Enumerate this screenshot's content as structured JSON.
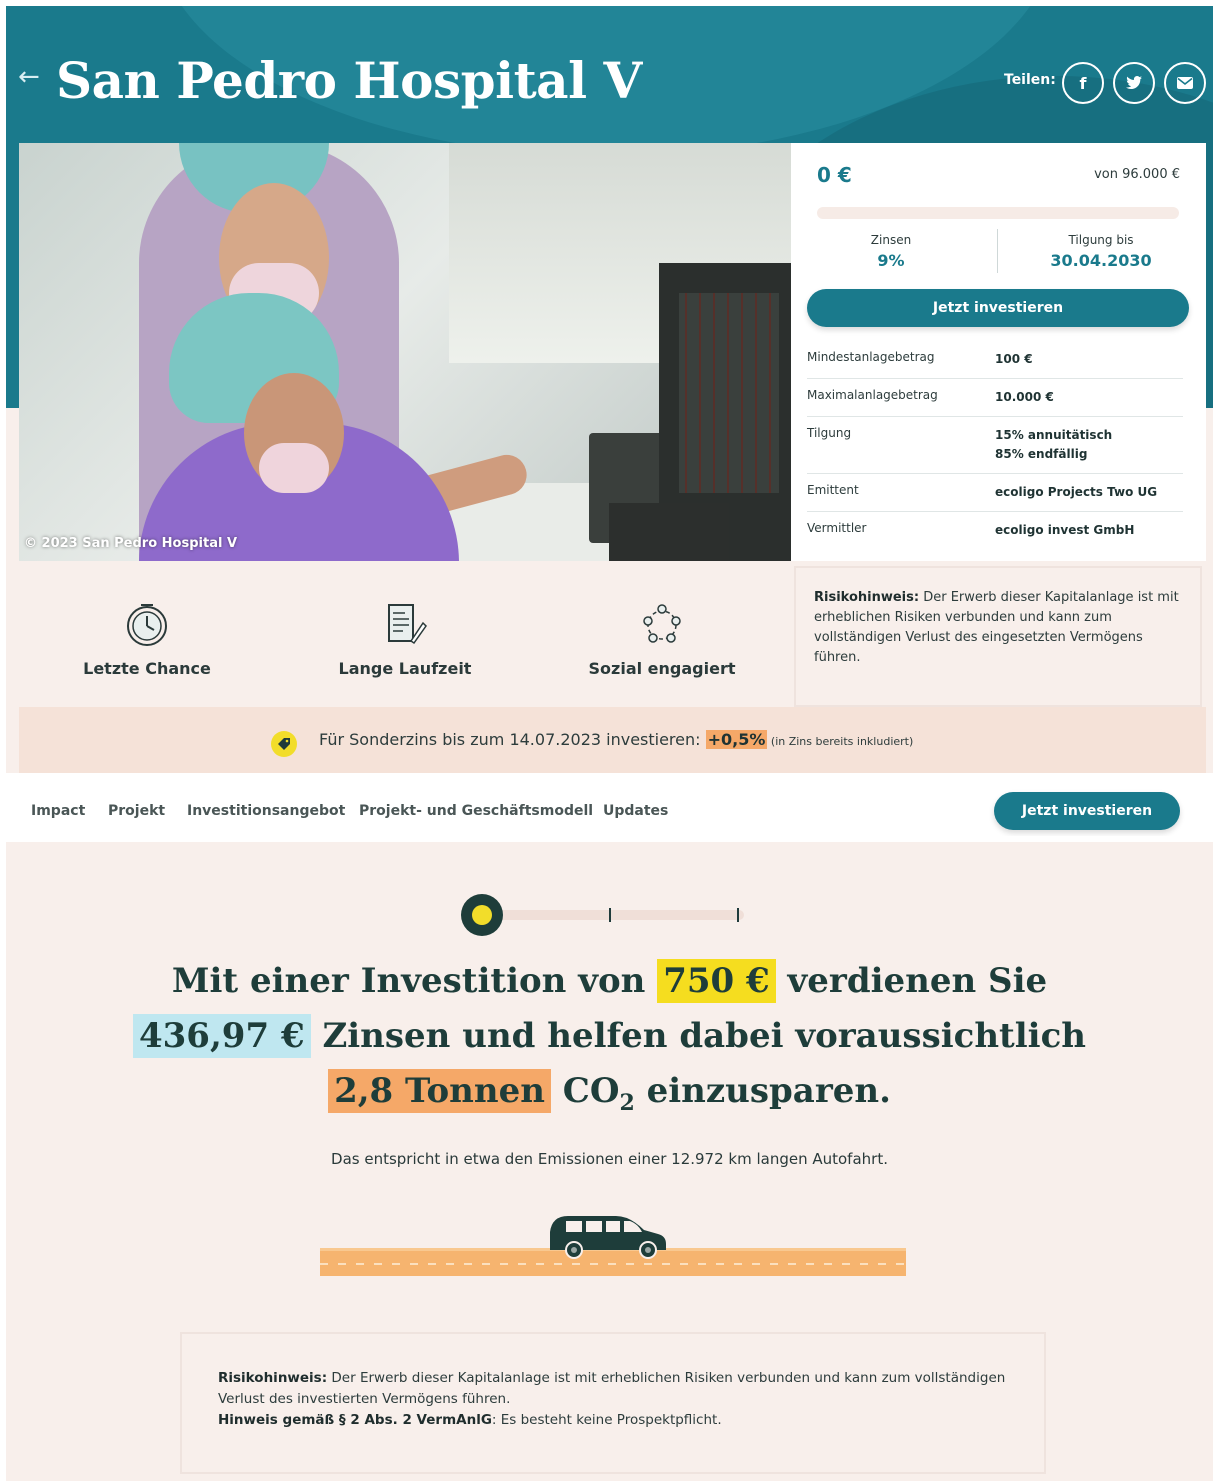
{
  "header": {
    "back_symbol": "←",
    "title": "San Pedro Hospital V",
    "share_label": "Teilen:",
    "share_buttons": [
      {
        "label": "f",
        "icon": "facebook-icon"
      },
      {
        "label": "t",
        "icon": "twitter-icon"
      },
      {
        "label": "✉",
        "icon": "mail-icon"
      }
    ]
  },
  "photo": {
    "caption": "© 2023 San Pedro Hospital V"
  },
  "invest_card": {
    "amount": "0 €",
    "of_total": "von 96.000 €",
    "progress": 0,
    "stats": [
      {
        "label": "Zinsen",
        "value": "9%"
      },
      {
        "label": "Tilgung bis",
        "value": "30.04.2030"
      }
    ],
    "cta_label": "Jetzt investieren",
    "details": [
      {
        "key": "Mindestanlagebetrag",
        "value": "100 €"
      },
      {
        "key": "Maximalanlagebetrag",
        "value": "10.000 €"
      },
      {
        "key": "Tilgung",
        "value": "15% annuitätisch\n85% endfällig"
      },
      {
        "key": "Emittent",
        "value": "ecoligo Projects Two UG"
      },
      {
        "key": "Vermittler",
        "value": "ecoligo invest GmbH"
      }
    ]
  },
  "features": [
    {
      "label": "Letzte Chance",
      "icon": "clock-icon"
    },
    {
      "label": "Lange Laufzeit",
      "icon": "document-icon"
    },
    {
      "label": "Sozial engagiert",
      "icon": "community-icon"
    }
  ],
  "risk_top": {
    "bold": "Risikohinweis:",
    "text": " Der Erwerb dieser Kapitalanlage ist mit erheblichen Risiken verbunden und kann zum vollständigen Verlust des eingesetzten Vermögens führen."
  },
  "promo": {
    "text": "Für Sonderzins bis zum 14.07.2023 investieren: ",
    "highlight": "+0,5%",
    "small": " (in Zins bereits inkludiert)"
  },
  "nav": {
    "items": [
      "Impact",
      "Projekt",
      "Investitionsangebot",
      "Projekt- und Geschäftsmodell",
      "Updates"
    ],
    "cta_label": "Jetzt investieren"
  },
  "impact": {
    "slider_position": 0,
    "line1_pre": "Mit einer Investition von ",
    "line1_amount": "750 €",
    "line1_post": " verdienen Sie",
    "line2_interest": "436,97 €",
    "line2_post": " Zinsen und helfen dabei voraussichtlich",
    "line3_co2": "2,8 Tonnen",
    "line3_co": " CO",
    "line3_sub": "2",
    "line3_post": " einzusparen.",
    "equivalent": "Das entspricht in etwa den Emissionen einer 12.972 km langen Autofahrt."
  },
  "risk_bottom": {
    "bold1": "Risikohinweis:",
    "text1": " Der Erwerb dieser Kapitalanlage ist mit erheblichen Risiken verbunden und kann zum vollständigen Verlust des investierten Vermögens führen.",
    "bold2": "Hinweis gemäß § 2 Abs. 2 VermAnlG",
    "text2": ": Es besteht keine Prospektpflicht."
  },
  "colors": {
    "primary": "#1a7a8c",
    "background": "#f8efeb",
    "highlight_yellow": "#f5dd1f",
    "highlight_blue": "#bfe7f0",
    "highlight_orange": "#f5a868"
  }
}
